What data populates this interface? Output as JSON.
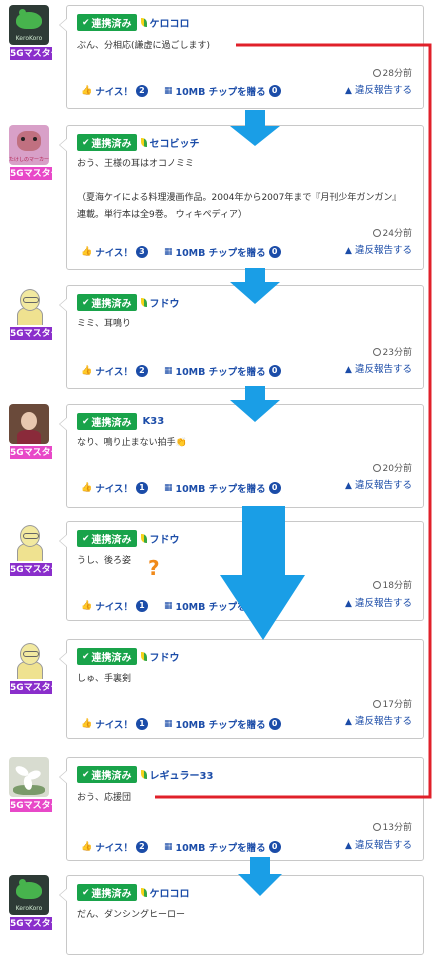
{
  "labels": {
    "linked": "連携済み",
    "nice": "ナイス！",
    "chip": "10MB チップを贈る",
    "report": "違反報告する"
  },
  "posts": [
    {
      "user": "ケロコロ",
      "rank": "5Gマスター",
      "avatar": "kerokoro",
      "text": "ぶん、分相応(謙虚に過ごします)",
      "time": "28分前",
      "nice": "2",
      "chips": "0"
    },
    {
      "user": "セコビッチ",
      "rank": "5Gマスター",
      "avatar": "cat",
      "text": "おう、王様の耳はオコノミミ\n\n（夏海ケイによる料理漫画作品。2004年から2007年まで『月刊少年ガンガン』連載。単行本は全9巻。 ウィキペディア）",
      "time": "24分前",
      "nice": "3",
      "chips": "0"
    },
    {
      "user": "フドウ",
      "rank": "5Gマスター",
      "avatar": "bird",
      "text": "ミミ、耳鳴り",
      "time": "23分前",
      "nice": "2",
      "chips": "0"
    },
    {
      "user": "K33",
      "rank": "5Gマスター",
      "avatar": "doll",
      "text": "なり、鳴り止まない拍手👏",
      "time": "20分前",
      "nice": "1",
      "chips": "0"
    },
    {
      "user": "フドウ",
      "rank": "5Gマスター",
      "avatar": "bird",
      "text": "うし、後ろ姿",
      "time": "18分前",
      "nice": "1",
      "chips": "0"
    },
    {
      "user": "フドウ",
      "rank": "5Gマスター",
      "avatar": "bird",
      "text": "しゅ、手裏剣",
      "time": "17分前",
      "nice": "1",
      "chips": "0"
    },
    {
      "user": "レギュラー33",
      "rank": "5Gマスター",
      "avatar": "flower",
      "text": "おう、応援団",
      "time": "13分前",
      "nice": "2",
      "chips": "0"
    },
    {
      "user": "ケロコロ",
      "rank": "5Gマスター",
      "avatar": "kerokoro",
      "text": "だん、ダンシングヒーロー",
      "time": "",
      "nice": "",
      "chips": ""
    }
  ],
  "avatar_captions": {
    "kerokoro": "KeroKoro",
    "cat": "たけしのマーカー"
  },
  "annotations": {
    "question_mark": "?",
    "arrow_color": "#1a9ee6",
    "line_color": "#e0202a"
  },
  "colors": {
    "linked_badge": "#19a34a",
    "link_text": "#1b4ca8",
    "rank_badge": "#8a2ecb",
    "rank_badge_alt": "#e848c8"
  }
}
